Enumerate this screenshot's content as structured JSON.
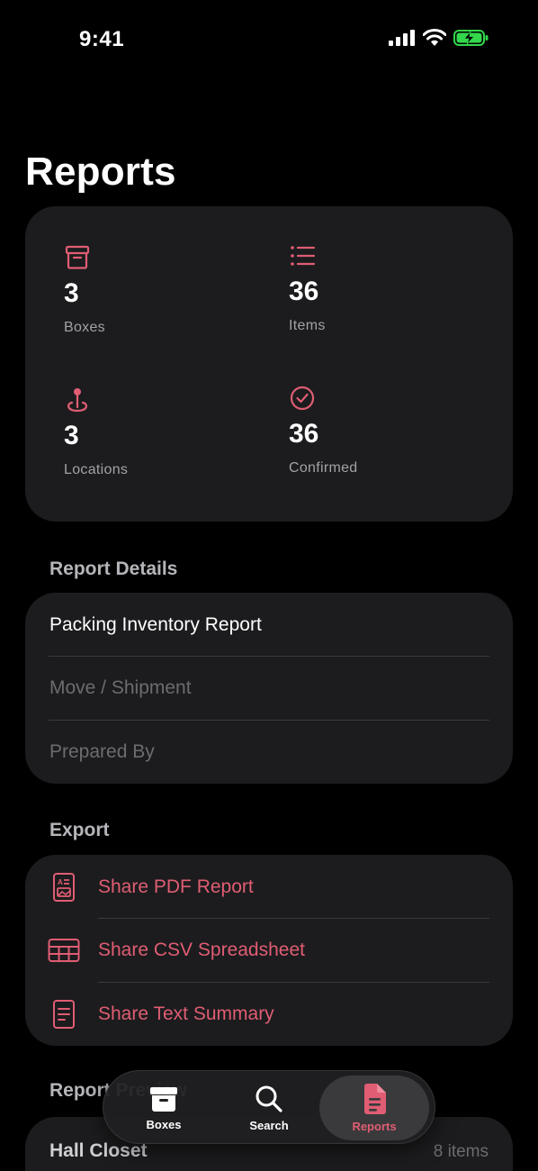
{
  "status_bar": {
    "time": "9:41"
  },
  "page": {
    "title": "Reports"
  },
  "stats": {
    "boxes": {
      "value": "3",
      "label": "Boxes",
      "icon": "archive-box-icon"
    },
    "items": {
      "value": "36",
      "label": "Items",
      "icon": "list-icon"
    },
    "locations": {
      "value": "3",
      "label": "Locations",
      "icon": "location-pin-icon"
    },
    "confirmed": {
      "value": "36",
      "label": "Confirmed",
      "icon": "checkmark-circle-icon"
    }
  },
  "report_details": {
    "section_label": "Report Details",
    "title_value": "Packing Inventory Report",
    "shipment_placeholder": "Move / Shipment",
    "prepared_by_placeholder": "Prepared By"
  },
  "export": {
    "section_label": "Export",
    "pdf_label": "Share PDF Report",
    "csv_label": "Share CSV Spreadsheet",
    "text_label": "Share Text Summary"
  },
  "preview": {
    "section_label": "Report Preview",
    "first_location": "Hall Closet",
    "first_count": "8 items"
  },
  "tabbar": {
    "boxes": "Boxes",
    "search": "Search",
    "reports": "Reports"
  },
  "colors": {
    "accent": "#e05d73",
    "card": "#1c1c1e",
    "background": "#000000",
    "battery": "#32d74b"
  }
}
